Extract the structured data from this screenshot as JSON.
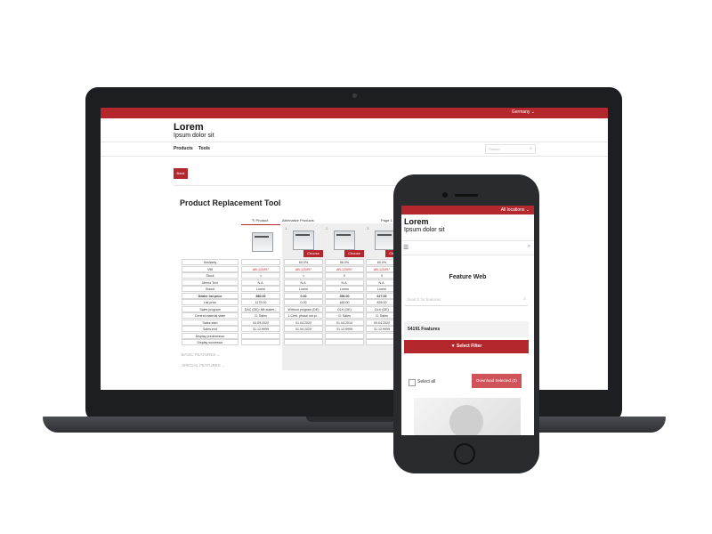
{
  "desktop": {
    "country": "Germany ⌄",
    "logo_title": "Lorem",
    "logo_subtitle": "Ipsum dolor sit",
    "nav": [
      "Products",
      "Tools"
    ],
    "search_placeholder": "Search",
    "back_label": "Back",
    "page_title": "Product Replacement Tool",
    "col_headers": [
      "Product",
      "Alternative Products",
      "Page 1"
    ],
    "choose_label": "Choose",
    "alt_numbers": [
      "1.",
      "2.",
      "3."
    ],
    "row_labels": [
      "Similarity",
      "VIB",
      "Stock",
      "Memo Text",
      "Brand",
      "Dealer list price",
      "List price",
      "Sales program",
      "Central material state",
      "Sales start",
      "Sales end",
      "Display predecessor",
      "Display successor"
    ],
    "columns": [
      [
        "",
        "AB-120097",
        "1",
        "N.A.",
        "Lorem",
        "880.00",
        "1179.00",
        "DAC (DE): Mit ausen...",
        "G: Sales",
        "04.09.2020",
        "31.12.9999",
        "",
        ""
      ],
      [
        "60.0%",
        "AB-120097",
        "1",
        "N.A.",
        "Lorem",
        "0.00",
        "0.00",
        "Without program (DE)",
        "1-Cent. phase out pl...",
        "01.04.2020",
        "01.04.2020",
        "",
        ""
      ],
      [
        "56.0%",
        "AB-120097",
        "0",
        "N.A.",
        "Lorem",
        "356.00",
        "489.00",
        "DLK (DE)",
        "G: Sales",
        "01.04.2014",
        "31.12.9999",
        "",
        ""
      ],
      [
        "60.0%",
        "AB-120097",
        "0",
        "N.A.",
        "Lorem",
        "627.00",
        "839.00",
        "DLK (DE)",
        "G: Sales",
        "09.04.2020",
        "31.12.9999",
        "",
        ""
      ]
    ],
    "basic_features": "BASIC FEATURES ⌄",
    "special_features": "SPECIAL FEATURES ⌄"
  },
  "mobile": {
    "locations": "All locations ⌄",
    "logo_title": "Lorem",
    "logo_subtitle": "Ipsum dolor sit",
    "menu_icon": "☰",
    "search_icon": "⌕",
    "title": "Feature Web",
    "search_placeholder": "Search for features",
    "feature_count": "54191 Features",
    "select_filter": "▼ Select Filter",
    "select_all": "Select all",
    "download_button": "Download Selected (0)"
  },
  "colors": {
    "brand": "#b4282d",
    "device": "#1d1e21"
  }
}
